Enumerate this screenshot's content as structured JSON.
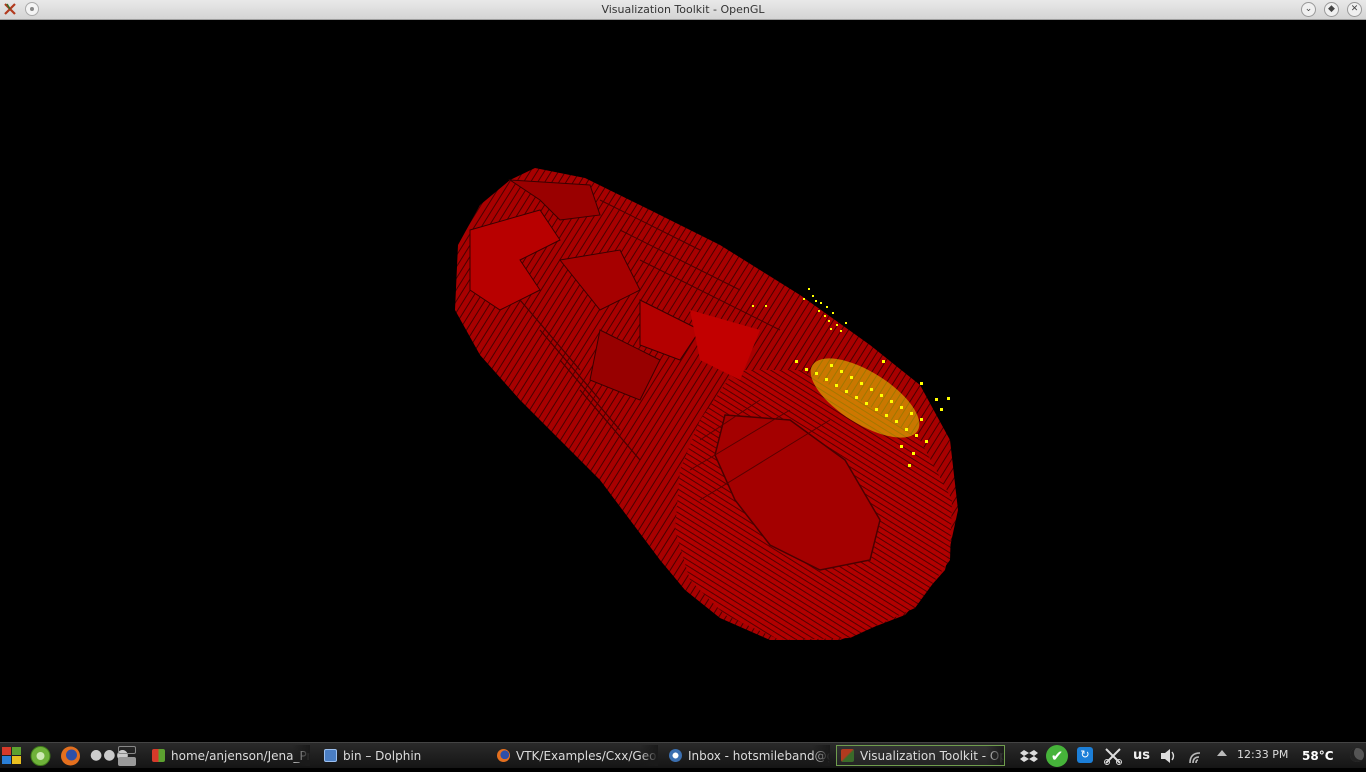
{
  "window": {
    "title": "Visualization Toolkit - OpenGL",
    "buttons": [
      "minimize",
      "maximize",
      "close"
    ]
  },
  "render": {
    "background": "#000000",
    "surface_color": "#b00000",
    "surface_dark": "#5a0000",
    "points_color": "#ffff00"
  },
  "taskbar": {
    "launchers": [
      "kde-menu-icon",
      "dolphin-home-icon",
      "firefox-icon",
      "more-icon",
      "desktop-pager-icon"
    ],
    "tasks": [
      {
        "label": "home/anjenson/Jena_Pr",
        "icon": "folder-app-icon",
        "active": false
      },
      {
        "label": "bin – Dolphin",
        "icon": "dolphin-icon",
        "active": false
      },
      {
        "label": "VTK/Examples/Cxx/Geom",
        "icon": "firefox-icon",
        "active": false
      },
      {
        "label": "Inbox - hotsmileband@g",
        "icon": "mail-icon",
        "active": false
      },
      {
        "label": "Visualization Toolkit - Op",
        "icon": "vtk-icon",
        "active": true
      }
    ],
    "tray": {
      "keyboard_layout": "us",
      "clock": "12:33 PM",
      "temperature": "58°C"
    }
  }
}
